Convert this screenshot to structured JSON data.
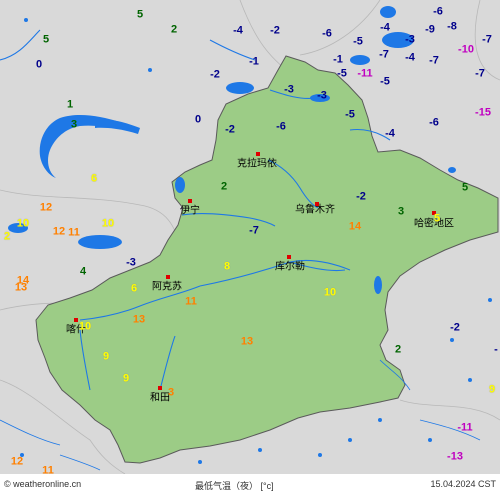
{
  "footer": {
    "site": "© weatheronline.cn",
    "title": "最低气温（夜） [°c]",
    "date": "15.04.2024 CST"
  },
  "colors": {
    "region_fill": "#9ccc86",
    "background": "#d9d9d9",
    "water": "#1e78e6",
    "temp_green": "#006400",
    "temp_blue": "#00008b",
    "temp_magenta": "#c000c0",
    "temp_orange": "#ff8000",
    "temp_yellow": "#ffff00"
  },
  "cities": [
    "克拉玛依",
    "伊宁",
    "乌鲁木齐",
    "哈密地区",
    "库尔勒",
    "阿克苏",
    "喀什",
    "和田"
  ],
  "temps": [
    {
      "t": "5",
      "c": "green"
    },
    {
      "t": "2",
      "c": "green"
    },
    {
      "t": "-4",
      "c": "blue"
    },
    {
      "t": "-2",
      "c": "blue"
    },
    {
      "t": "-4",
      "c": "blue"
    },
    {
      "t": "-6",
      "c": "blue"
    },
    {
      "t": "-6",
      "c": "blue"
    },
    {
      "t": "-8",
      "c": "blue"
    },
    {
      "t": "-1",
      "c": "blue"
    },
    {
      "t": "5",
      "c": "green"
    },
    {
      "t": "-5",
      "c": "blue"
    },
    {
      "t": "-3",
      "c": "blue"
    },
    {
      "t": "-9",
      "c": "blue"
    },
    {
      "t": "-10",
      "c": "magenta"
    },
    {
      "t": "-7",
      "c": "blue"
    },
    {
      "t": "0",
      "c": "blue"
    },
    {
      "t": "-2",
      "c": "blue"
    },
    {
      "t": "-1",
      "c": "blue"
    },
    {
      "t": "-4",
      "c": "blue"
    },
    {
      "t": "-7",
      "c": "blue"
    },
    {
      "t": "-5",
      "c": "blue"
    },
    {
      "t": "-7",
      "c": "blue"
    },
    {
      "t": "-11",
      "c": "magenta"
    },
    {
      "t": "-5",
      "c": "blue"
    },
    {
      "t": "-7",
      "c": "blue"
    },
    {
      "t": "-3",
      "c": "blue"
    },
    {
      "t": "-3",
      "c": "blue"
    },
    {
      "t": "1",
      "c": "green"
    },
    {
      "t": "3",
      "c": "green"
    },
    {
      "t": "0",
      "c": "blue"
    },
    {
      "t": "-5",
      "c": "blue"
    },
    {
      "t": "-15",
      "c": "magenta"
    },
    {
      "t": "-2",
      "c": "blue"
    },
    {
      "t": "-6",
      "c": "blue"
    },
    {
      "t": "-4",
      "c": "blue"
    },
    {
      "t": "-6",
      "c": "blue"
    },
    {
      "t": "2",
      "c": "green"
    },
    {
      "t": "6",
      "c": "yellow"
    },
    {
      "t": "-2",
      "c": "blue"
    },
    {
      "t": "5",
      "c": "green"
    },
    {
      "t": "12",
      "c": "orange"
    },
    {
      "t": "3",
      "c": "green"
    },
    {
      "t": "5",
      "c": "yellow"
    },
    {
      "t": "14",
      "c": "orange"
    },
    {
      "t": "12",
      "c": "orange"
    },
    {
      "t": "11",
      "c": "orange"
    },
    {
      "t": "10",
      "c": "yellow"
    },
    {
      "t": "-7",
      "c": "blue"
    },
    {
      "t": "10",
      "c": "yellow"
    },
    {
      "t": "2",
      "c": "yellow"
    },
    {
      "t": "8",
      "c": "yellow"
    },
    {
      "t": "-3",
      "c": "blue"
    },
    {
      "t": "4",
      "c": "green"
    },
    {
      "t": "13",
      "c": "orange"
    },
    {
      "t": "14",
      "c": "orange"
    },
    {
      "t": "6",
      "c": "yellow"
    },
    {
      "t": "10",
      "c": "yellow"
    },
    {
      "t": "11",
      "c": "orange"
    },
    {
      "t": "13",
      "c": "orange"
    },
    {
      "t": "10",
      "c": "yellow"
    },
    {
      "t": "-2",
      "c": "blue"
    },
    {
      "t": "-",
      "c": "blue"
    },
    {
      "t": "13",
      "c": "orange"
    },
    {
      "t": "9",
      "c": "yellow"
    },
    {
      "t": "2",
      "c": "green"
    },
    {
      "t": "9",
      "c": "yellow"
    },
    {
      "t": "9",
      "c": "yellow"
    },
    {
      "t": "3",
      "c": "orange"
    },
    {
      "t": "-11",
      "c": "magenta"
    },
    {
      "t": "-13",
      "c": "magenta"
    },
    {
      "t": "12",
      "c": "orange"
    },
    {
      "t": "11",
      "c": "orange"
    },
    {
      "t": "5",
      "c": "yellow"
    }
  ]
}
